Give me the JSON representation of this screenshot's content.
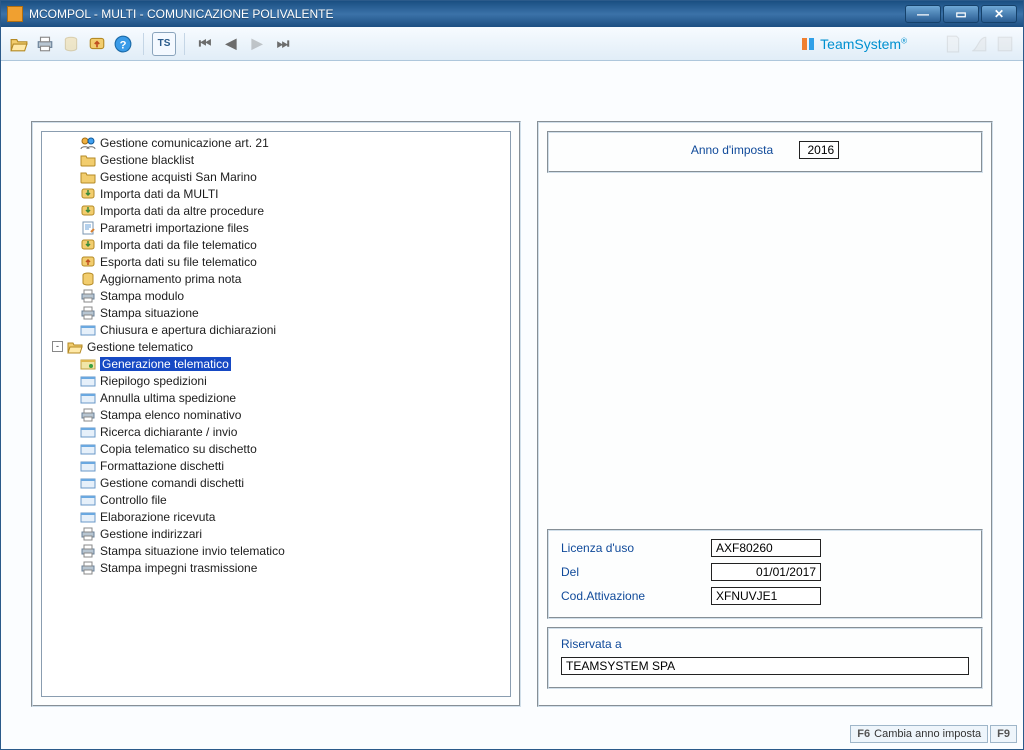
{
  "window": {
    "title": "MCOMPOL  - MULTI -  COMUNICAZIONE POLIVALENTE"
  },
  "brand": {
    "name": "TeamSystem"
  },
  "toolbar": {
    "open": "open-icon",
    "print": "print-icon",
    "multi": "multi-icon",
    "export": "export-icon",
    "help": "help-icon",
    "ts": "TS",
    "nav_first": "first",
    "nav_prev": "prev",
    "nav_next": "next",
    "nav_last": "last"
  },
  "tree": {
    "parent_label": "Gestione telematico",
    "items": [
      {
        "label": "Gestione comunicazione art. 21",
        "icon": "users",
        "indent": 1
      },
      {
        "label": "Gestione blacklist",
        "icon": "folder",
        "indent": 1
      },
      {
        "label": "Gestione acquisti San Marino",
        "icon": "folder",
        "indent": 1
      },
      {
        "label": "Importa dati da MULTI",
        "icon": "import",
        "indent": 1
      },
      {
        "label": "Importa dati da altre procedure",
        "icon": "import",
        "indent": 1
      },
      {
        "label": "Parametri importazione files",
        "icon": "note",
        "indent": 1
      },
      {
        "label": "Importa dati da file telematico",
        "icon": "import",
        "indent": 1
      },
      {
        "label": "Esporta dati su file telematico",
        "icon": "export",
        "indent": 1
      },
      {
        "label": "Aggiornamento prima nota",
        "icon": "db",
        "indent": 1
      },
      {
        "label": "Stampa modulo",
        "icon": "printer",
        "indent": 1
      },
      {
        "label": "Stampa situazione",
        "icon": "printer",
        "indent": 1
      },
      {
        "label": "Chiusura e apertura dichiarazioni",
        "icon": "card",
        "indent": 1
      },
      {
        "label": "Gestione telematico",
        "icon": "open-folder",
        "indent": 0,
        "parent": true,
        "expander": "-"
      },
      {
        "label": "Generazione telematico",
        "icon": "card-sel",
        "indent": 1,
        "selected": true
      },
      {
        "label": "Riepilogo spedizioni",
        "icon": "card",
        "indent": 1
      },
      {
        "label": "Annulla ultima spedizione",
        "icon": "card",
        "indent": 1
      },
      {
        "label": "Stampa elenco nominativo",
        "icon": "printer",
        "indent": 1
      },
      {
        "label": "Ricerca dichiarante / invio",
        "icon": "card",
        "indent": 1
      },
      {
        "label": "Copia telematico su dischetto",
        "icon": "card",
        "indent": 1
      },
      {
        "label": "Formattazione dischetti",
        "icon": "card",
        "indent": 1
      },
      {
        "label": "Gestione comandi dischetti",
        "icon": "card",
        "indent": 1
      },
      {
        "label": "Controllo file",
        "icon": "card",
        "indent": 1
      },
      {
        "label": "Elaborazione ricevuta",
        "icon": "card",
        "indent": 1
      },
      {
        "label": "Gestione indirizzari",
        "icon": "printer",
        "indent": 1
      },
      {
        "label": "Stampa situazione invio telematico",
        "icon": "printer",
        "indent": 1
      },
      {
        "label": "Stampa impegni trasmissione",
        "icon": "printer",
        "indent": 1
      }
    ]
  },
  "form": {
    "year_label": "Anno d'imposta",
    "year_value": "2016",
    "license_label": "Licenza d'uso",
    "license_value": "AXF80260",
    "date_label": "Del",
    "date_value": "01/01/2017",
    "activation_label": "Cod.Attivazione",
    "activation_value": "XFNUVJE1",
    "reserved_label": "Riservata a",
    "reserved_value": "TEAMSYSTEM SPA"
  },
  "status": {
    "f6_key": "F6",
    "f6_label": "Cambia anno imposta",
    "f9_key": "F9"
  }
}
